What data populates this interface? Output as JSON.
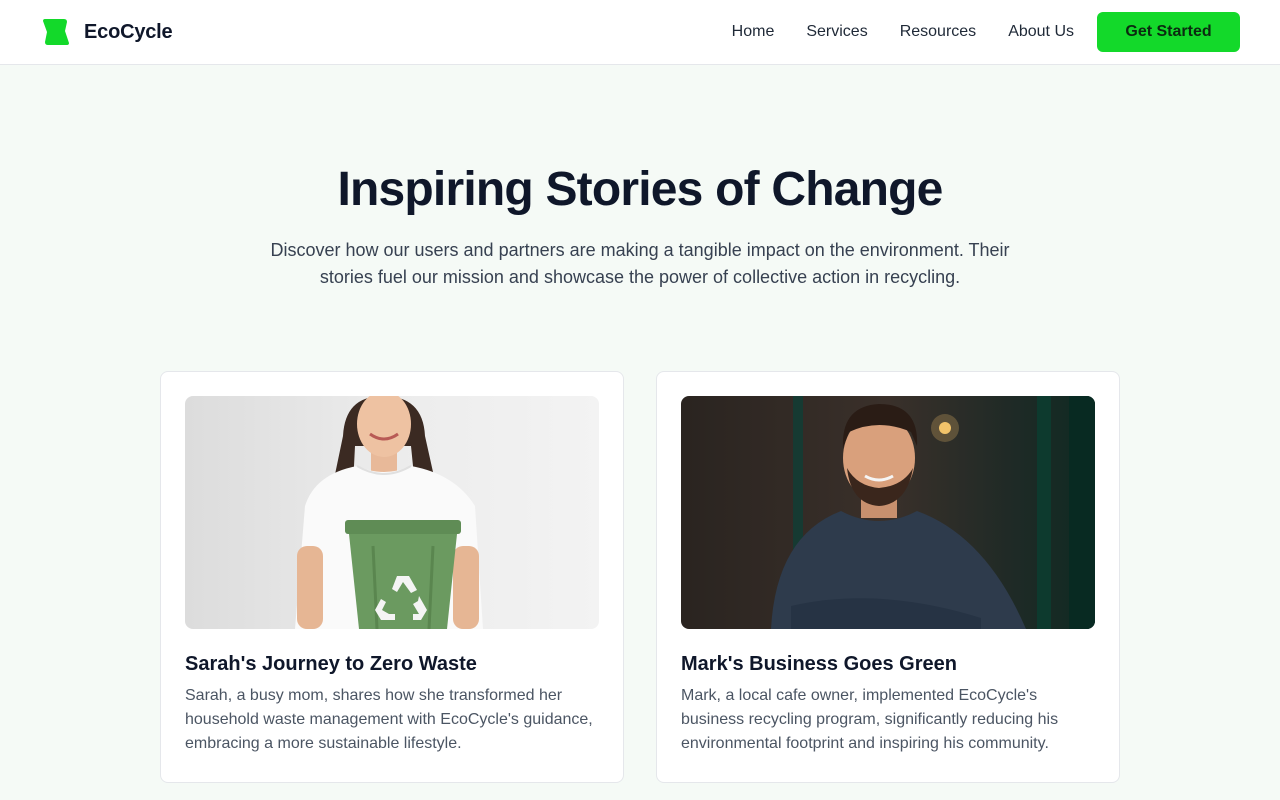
{
  "header": {
    "brand_name": "EcoCycle",
    "logo_icon": "leaf-block-icon",
    "brand_color": "#13d92a",
    "nav": [
      "Home",
      "Services",
      "Resources",
      "About Us"
    ],
    "cta_label": "Get Started"
  },
  "hero": {
    "title": "Inspiring Stories of Change",
    "subtitle": "Discover how our users and partners are making a tangible impact on the environment. Their stories fuel our mission and showcase the power of collective action in recycling."
  },
  "stories": [
    {
      "title": "Sarah's Journey to Zero Waste",
      "text": "Sarah, a busy mom, shares how she transformed her household waste management with EcoCycle's guidance, embracing a more sustainable lifestyle."
    },
    {
      "title": "Mark's Business Goes Green",
      "text": "Mark, a local cafe owner, implemented EcoCycle's business recycling program, significantly reducing his environmental footprint and inspiring his community."
    }
  ]
}
